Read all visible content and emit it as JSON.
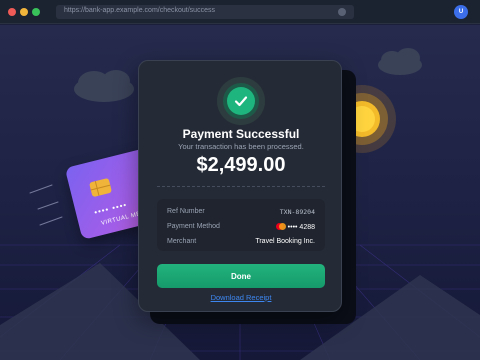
{
  "browser": {
    "url": "https://bank-app.example.com/checkout/success",
    "user_initial": "U"
  },
  "card": {
    "number_masked": "•••• ••••",
    "label": "VIRTUAL MEMBER"
  },
  "modal": {
    "title": "Payment Successful",
    "subtitle": "Your transaction has been processed.",
    "amount": "$2,499.00",
    "details": [
      {
        "label": "Ref Number",
        "value": "TXN-89204"
      },
      {
        "label": "Payment Method",
        "value": "•••• 4288"
      },
      {
        "label": "Merchant",
        "value": "Travel Booking Inc."
      }
    ],
    "done_label": "Done",
    "receipt_link": "Download Receipt"
  },
  "colors": {
    "accent_green": "#1fb57e",
    "link_blue": "#3d86f0",
    "background": "#1b1f3a"
  }
}
